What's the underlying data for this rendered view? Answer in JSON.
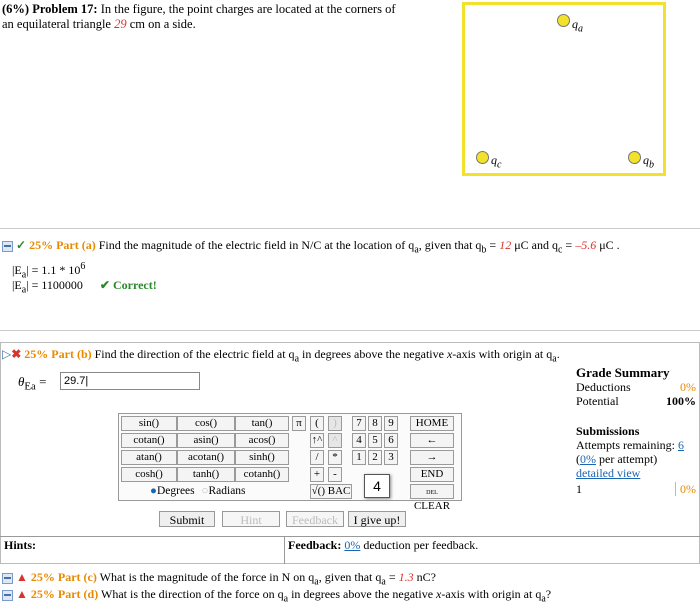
{
  "problem": {
    "weight": "(6%)",
    "number": "Problem 17:",
    "text_a": "In the figure, the point charges are located at the corners of",
    "text_b": "an equilateral triangle",
    "side": "29",
    "text_c": "cm on a side."
  },
  "figure": {
    "label_a": "q",
    "sub_a": "a",
    "label_b": "q",
    "sub_b": "b",
    "label_c": "q",
    "sub_c": "c",
    "color_frame": "#f2e22c"
  },
  "part_a": {
    "percent": "25%",
    "label": "Part (a)",
    "question_1": "Find the magnitude of the electric field in N/C at the location of q",
    "question_sub": "a",
    "question_2": ", given that q",
    "qb_sub": "b",
    "eq": " = ",
    "qb_val": "12",
    "unit_1": " μC and q",
    "qc_sub": "c",
    "eq2": " = ",
    "qc_val": "–5.6",
    "unit_2": " μC .",
    "ans1_lhs": "|E",
    "ans1_sub": "a",
    "ans1_rhs": "| = 1.1 * 10",
    "ans1_exp": "6",
    "ans2_lhs": "|E",
    "ans2_sub": "a",
    "ans2_rhs": "| = 1100000",
    "correct": "Correct!"
  },
  "part_b": {
    "percent": "25%",
    "label": "Part (b)",
    "question_1": "Find the direction of the electric field at q",
    "question_sub": "a",
    "question_2": " in degrees above the negative ",
    "axis": "x",
    "question_3": "-axis with origin at q",
    "question_sub2": "a",
    "question_end": ".",
    "theta": "θ",
    "theta_sub": "Ea",
    "eq": " = ",
    "input_value": "29.7",
    "keypad": {
      "funcs": [
        [
          "sin()",
          "cos()",
          "tan()"
        ],
        [
          "cotan()",
          "asin()",
          "acos()"
        ],
        [
          "atan()",
          "acotan()",
          "sinh()"
        ],
        [
          "cosh()",
          "tanh()",
          "cotanh()"
        ]
      ],
      "degrees": "Degrees",
      "radians": "Radians",
      "pi": "π",
      "lparen": "(",
      "rparen": ")",
      "up": "↑^",
      "hat": "^",
      "slash": "/",
      "star": "*",
      "plus": "+",
      "minus": "-",
      "sqrt": "√()",
      "back": "BAC",
      "digits": [
        [
          "7",
          "8",
          "9"
        ],
        [
          "4",
          "5",
          "6"
        ],
        [
          "1",
          "2",
          "3"
        ]
      ],
      "zero": "0",
      "dot": ".",
      "home": "HOME",
      "left": "←",
      "right": "→",
      "end": "END",
      "del": "DEL",
      "clear": "CLEAR",
      "badge": "4"
    },
    "submit": "Submit",
    "hint": "Hint",
    "feedback_btn": "Feedback",
    "give_up": "I give up!",
    "hints_label": "Hints:",
    "feedback_label": "Feedback:",
    "feedback_pct": "0%",
    "feedback_text": "deduction per feedback."
  },
  "grade_summary": {
    "title": "Grade Summary",
    "deductions_label": "Deductions",
    "deductions_val": "0%",
    "potential_label": "Potential",
    "potential_val": "100%",
    "submissions_title": "Submissions",
    "attempts_label": "Attempts remaining:",
    "attempts_val": "6",
    "per_attempt_pct": "0%",
    "per_attempt_text": " per attempt)",
    "per_attempt_open": "(",
    "detailed_view": "detailed view",
    "row_num": "1",
    "row_pct": "0%"
  },
  "part_c": {
    "percent": "25%",
    "label": "Part (c)",
    "q1": "What is the magnitude of the force in N on q",
    "sub": "a",
    "q2": ", given that q",
    "sub2": "a",
    "eq": " = ",
    "val": "1.3",
    "unit": " nC?"
  },
  "part_d": {
    "percent": "25%",
    "label": "Part (d)",
    "q1": "What is the direction of the force on q",
    "sub": "a",
    "q2": " in degrees above the negative ",
    "axis": "x",
    "q3": "-axis with origin at q",
    "sub2": "a",
    "q4": "?"
  },
  "colors": {
    "accent_red": "#d9342b",
    "accent_orange": "#e88a00",
    "correct_green": "#2a8a2a",
    "link_blue": "#1a66b3"
  }
}
